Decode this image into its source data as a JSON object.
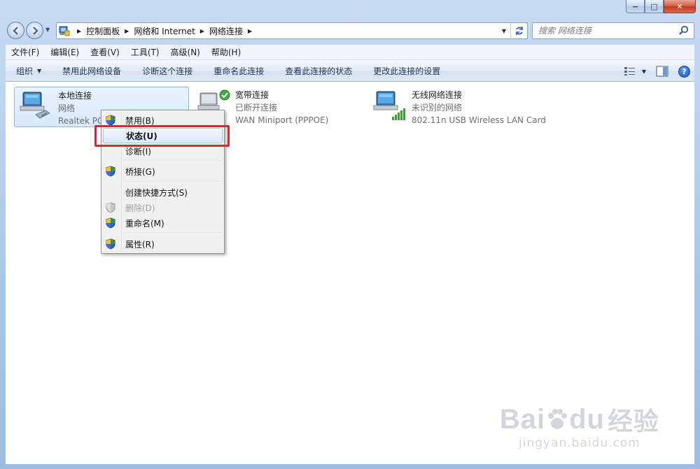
{
  "window": {
    "caption": {
      "minimize": "−",
      "maximize": "□",
      "close": "✕"
    }
  },
  "address": {
    "crumbs": [
      "控制面板",
      "网络和 Internet",
      "网络连接"
    ]
  },
  "search": {
    "placeholder": "搜索 网络连接"
  },
  "menubar": [
    "文件(F)",
    "编辑(E)",
    "查看(V)",
    "工具(T)",
    "高级(N)",
    "帮助(H)"
  ],
  "commands": {
    "organize": "组织",
    "disable_device": "禁用此网络设备",
    "diagnose": "诊断这个连接",
    "rename": "重命名此连接",
    "view_status": "查看此连接的状态",
    "change_settings": "更改此连接的设置"
  },
  "connections": [
    {
      "name": "本地连接",
      "status": "网络",
      "device": "Realtek PCIe"
    },
    {
      "name": "宽带连接",
      "status": "已断开连接",
      "device": "WAN Miniport (PPPOE)"
    },
    {
      "name": "无线网络连接",
      "status": "未识别的网络",
      "device": "802.11n USB Wireless LAN Card"
    }
  ],
  "context_menu": {
    "disable": "禁用(B)",
    "status": "状态(U)",
    "diagnose": "诊断(I)",
    "bridge": "桥接(G)",
    "shortcut": "创建快捷方式(S)",
    "delete": "删除(D)",
    "rename": "重命名(M)",
    "properties": "属性(R)"
  },
  "colors": {
    "highlight": "#e0242e",
    "selection": "#d8e8fb"
  }
}
